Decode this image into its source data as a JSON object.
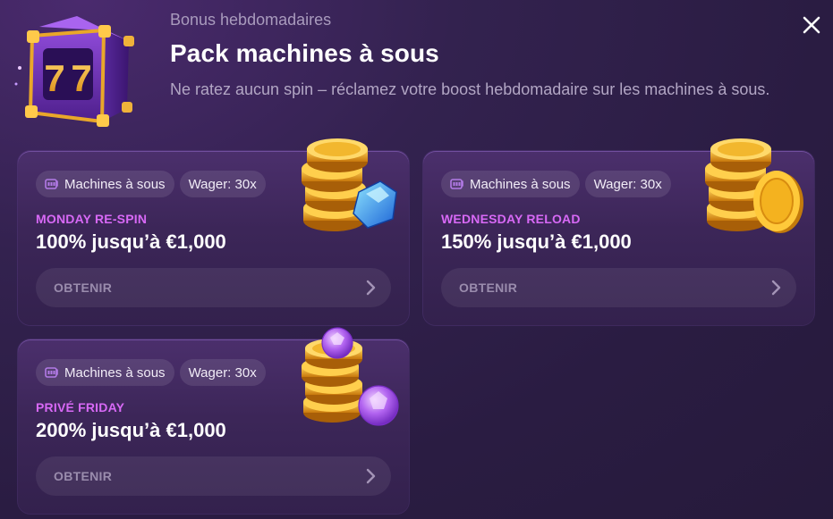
{
  "header": {
    "subtitle": "Bonus hebdomadaires",
    "title": "Pack machines à sous",
    "description": "Ne ratez aucun spin – réclamez votre boost hebdomadaire sur les machines à sous."
  },
  "close_icon": "close-icon",
  "colors": {
    "background": "#2a1c42",
    "card": "#3c2658",
    "promo_name": "#d869f6",
    "button_text": "#9a8cad"
  },
  "cards": [
    {
      "tag_category": "Machines à sous",
      "tag_wager": "Wager: 30x",
      "promo_name": "MONDAY RE-SPIN",
      "offer": "100% jusqu’à €1,000",
      "button_label": "OBTENIR",
      "art": "coins-with-blue-gem"
    },
    {
      "tag_category": "Machines à sous",
      "tag_wager": "Wager: 30x",
      "promo_name": "WEDNESDAY RELOAD",
      "offer": "150% jusqu’à €1,000",
      "button_label": "OBTENIR",
      "art": "coin-stack"
    },
    {
      "tag_category": "Machines à sous",
      "tag_wager": "Wager: 30x",
      "promo_name": "PRIVÉ FRIDAY",
      "offer": "200% jusqu’à €1,000",
      "button_label": "OBTENIR",
      "art": "coins-with-purple-gems"
    }
  ]
}
